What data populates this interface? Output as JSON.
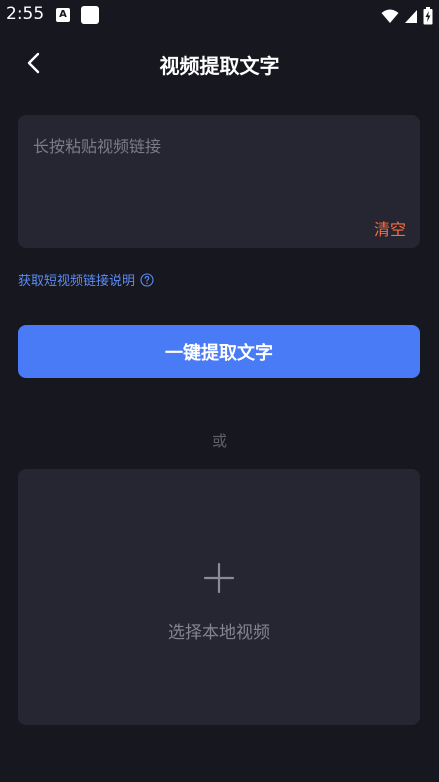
{
  "status_bar": {
    "time": "2:55",
    "app_icon_a": "A",
    "icons": [
      "wifi-icon",
      "signal-icon",
      "battery-charging-icon"
    ]
  },
  "nav": {
    "title": "视频提取文字",
    "back_icon": "chevron-left-icon"
  },
  "link_input": {
    "placeholder": "长按粘贴视频链接",
    "value": "",
    "clear_label": "清空"
  },
  "help": {
    "label": "获取短视频链接说明",
    "icon": "question-circle-icon"
  },
  "extract_button": {
    "label": "一键提取文字"
  },
  "divider": {
    "label": "或"
  },
  "local_video": {
    "label": "选择本地视频",
    "icon": "plus-icon"
  },
  "colors": {
    "background": "#17171f",
    "card": "#252632",
    "accent_blue": "#4a7bf6",
    "link_blue": "#5d8cf5",
    "clear_orange": "#ff6a3c"
  }
}
